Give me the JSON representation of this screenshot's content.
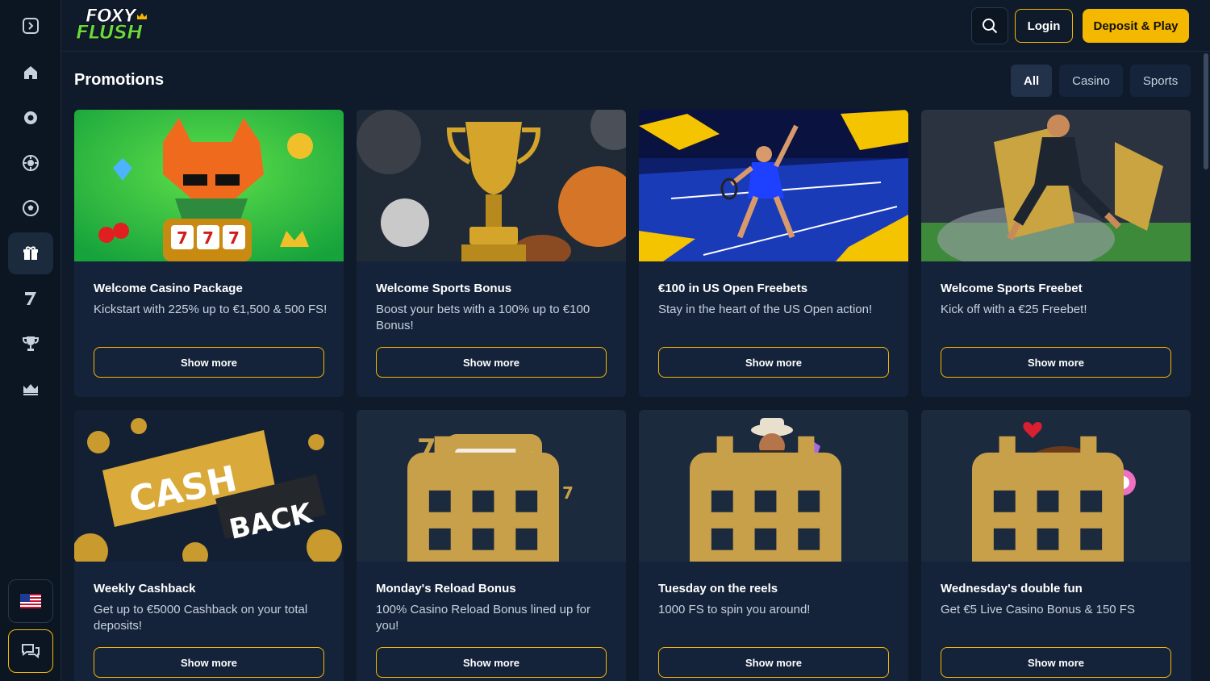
{
  "brand": {
    "line1": "FOXY",
    "line2": "FLUSH",
    "accent": "#f5b800",
    "green": "#6cd93b"
  },
  "sidebar": {
    "items": [
      {
        "name": "expand-icon"
      },
      {
        "name": "home-icon"
      },
      {
        "name": "casino-chip-icon"
      },
      {
        "name": "roulette-icon"
      },
      {
        "name": "football-icon"
      },
      {
        "name": "gift-icon",
        "active": true
      },
      {
        "name": "seven-icon"
      },
      {
        "name": "trophy-icon"
      },
      {
        "name": "crown-icon"
      }
    ],
    "language_flag": "us-flag-icon",
    "chat": "chat-icon"
  },
  "header": {
    "login_label": "Login",
    "deposit_label": "Deposit & Play"
  },
  "main": {
    "title": "Promotions",
    "filters": [
      "All",
      "Casino",
      "Sports"
    ],
    "active_filter": "All"
  },
  "promotions": [
    {
      "title": "Welcome Casino Package",
      "desc": "Kickstart with 225% up to €1,500 & 500 FS!",
      "button": "Show more"
    },
    {
      "title": "Welcome Sports Bonus",
      "desc": "Boost your bets with a 100% up to €100 Bonus!",
      "button": "Show more"
    },
    {
      "title": "€100 in US Open Freebets",
      "desc": "Stay in the heart of the US Open action!",
      "button": "Show more"
    },
    {
      "title": "Welcome Sports Freebet",
      "desc": "Kick off with a €25 Freebet!",
      "button": "Show more"
    },
    {
      "title": "Weekly Cashback",
      "desc": "Get up to €5000 Cashback on your total deposits!",
      "button": "Show more",
      "image_text_1": "CASH",
      "image_text_2": "BACK"
    },
    {
      "title": "Monday's Reload Bonus",
      "desc": "100% Casino Reload Bonus lined up for you!",
      "button": "Show more"
    },
    {
      "title": "Tuesday on the reels",
      "desc": "1000 FS to spin you around!",
      "button": "Show more"
    },
    {
      "title": "Wednesday's double fun",
      "desc": "Get €5 Live Casino Bonus & 150 FS",
      "button": "Show more"
    }
  ]
}
